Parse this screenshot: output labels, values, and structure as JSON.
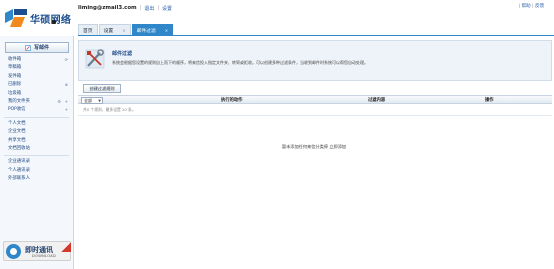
{
  "header": {
    "logo_text": "华硕网络",
    "user_email": "liming@zmail3.com",
    "logout": "退出",
    "settings": "设置",
    "top_help": "帮助",
    "top_feedback": "反馈",
    "top_sep": "|"
  },
  "tabs": [
    {
      "label": "首页",
      "closable": false
    },
    {
      "label": "设置",
      "closable": true
    },
    {
      "label": "邮件过滤",
      "closable": true,
      "active": true
    }
  ],
  "sidebar": {
    "compose": "写邮件",
    "items": [
      {
        "label": "收件箱"
      },
      {
        "label": "草稿箱"
      },
      {
        "label": "发件箱"
      },
      {
        "label": "已删除"
      },
      {
        "label": "垃圾箱"
      },
      {
        "label": "我的文件夹"
      },
      {
        "label": "POP收信"
      }
    ],
    "files": [
      {
        "label": "个人文档"
      },
      {
        "label": "企业文档"
      },
      {
        "label": "共享文档"
      },
      {
        "label": "文档回收站"
      }
    ],
    "contacts": [
      {
        "label": "企业通讯录"
      },
      {
        "label": "个人通讯录"
      },
      {
        "label": "外部联系人"
      }
    ],
    "chat": {
      "title": "即时通讯",
      "sub": "DOWNLOAD"
    }
  },
  "filter": {
    "title": "邮件过滤",
    "description": "系统会根据您设置的规则自上而下的顺序，将来信投入指定文件夹、转寄或拒收。可以创建多种过滤条件，当收到邮件时系统可以帮您自动处理。",
    "create_button": "创建过滤规则"
  },
  "table": {
    "select_value": "全部",
    "columns": [
      "执行的动作",
      "过滤内容",
      "操作"
    ],
    "count_text": "共0 个规则，最多设置 20 条。",
    "empty_text": "暂未添加任何来信分类停 立即添加"
  },
  "colors": {
    "accent": "#2f87c9",
    "link": "#2a5ca8",
    "brand": "#1d4f8f"
  }
}
